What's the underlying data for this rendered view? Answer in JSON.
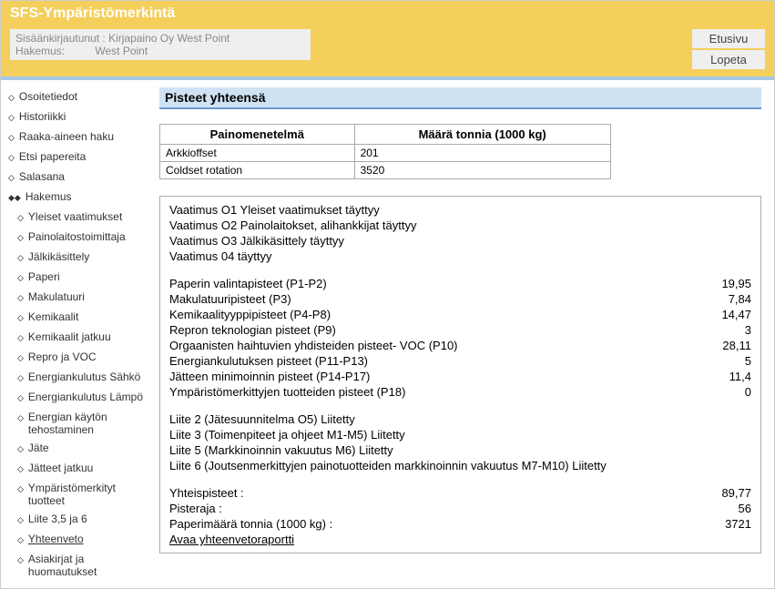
{
  "header": {
    "title": "SFS-Ympäristömerkintä",
    "loggedInLabel": "Sisäänkirjautunut :",
    "loggedInValue": "Kirjapaino Oy West Point",
    "appLabel": "Hakemus:",
    "appValue": "West Point",
    "btnHome": "Etusivu",
    "btnQuit": "Lopeta"
  },
  "sidebar": {
    "items": [
      {
        "label": "Osoitetiedot",
        "sub": false,
        "active": false
      },
      {
        "label": "Historiikki",
        "sub": false,
        "active": false
      },
      {
        "label": "Raaka-aineen haku",
        "sub": false,
        "active": false
      },
      {
        "label": "Etsi papereita",
        "sub": false,
        "active": false
      },
      {
        "label": "Salasana",
        "sub": false,
        "active": false
      },
      {
        "label": "Hakemus",
        "sub": false,
        "active": true
      },
      {
        "label": "Yleiset vaatimukset",
        "sub": true,
        "active": false
      },
      {
        "label": "Painolaitostoimittaja",
        "sub": true,
        "active": false
      },
      {
        "label": "Jälkikäsittely",
        "sub": true,
        "active": false
      },
      {
        "label": "Paperi",
        "sub": true,
        "active": false
      },
      {
        "label": "Makulatuuri",
        "sub": true,
        "active": false
      },
      {
        "label": "Kemikaalit",
        "sub": true,
        "active": false
      },
      {
        "label": "Kemikaalit jatkuu",
        "sub": true,
        "active": false
      },
      {
        "label": "Repro ja VOC",
        "sub": true,
        "active": false
      },
      {
        "label": "Energiankulutus Sähkö",
        "sub": true,
        "active": false
      },
      {
        "label": "Energiankulutus Lämpö",
        "sub": true,
        "active": false
      },
      {
        "label": "Energian käytön tehostaminen",
        "sub": true,
        "active": false
      },
      {
        "label": "Jäte",
        "sub": true,
        "active": false
      },
      {
        "label": "Jätteet jatkuu",
        "sub": true,
        "active": false
      },
      {
        "label": "Ympäristömerkityt tuotteet",
        "sub": true,
        "active": false
      },
      {
        "label": "Liite 3,5 ja 6",
        "sub": true,
        "active": false
      },
      {
        "label": "Yhteenveto",
        "sub": true,
        "active": false,
        "underline": true
      },
      {
        "label": "Asiakirjat ja huomautukset",
        "sub": true,
        "active": false
      }
    ]
  },
  "content": {
    "title": "Pisteet yhteensä",
    "tableHeaders": {
      "method": "Painomenetelmä",
      "amount": "Määrä tonnia (1000 kg)"
    },
    "tableRows": [
      {
        "method": "Arkkioffset",
        "amount": "201"
      },
      {
        "method": "Coldset rotation",
        "amount": "3520"
      }
    ],
    "reqs": [
      "Vaatimus O1 Yleiset vaatimukset täyttyy",
      "Vaatimus O2 Painolaitokset, alihankkijat täyttyy",
      "Vaatimus O3 Jälkikäsittely täyttyy",
      "Vaatimus 04 täyttyy"
    ],
    "scores": [
      {
        "label": "Paperin valintapisteet (P1-P2)",
        "value": "19,95"
      },
      {
        "label": "Makulatuuripisteet (P3)",
        "value": "7,84"
      },
      {
        "label": "Kemikaalityyppipisteet (P4-P8)",
        "value": "14,47"
      },
      {
        "label": "Repron teknologian pisteet (P9)",
        "value": "3"
      },
      {
        "label": "Orgaanisten haihtuvien yhdisteiden pisteet- VOC (P10)",
        "value": "28,11"
      },
      {
        "label": "Energiankulutuksen pisteet (P11-P13)",
        "value": "5"
      },
      {
        "label": "Jätteen minimoinnin pisteet (P14-P17)",
        "value": "11,4"
      },
      {
        "label": "Ympäristömerkittyjen tuotteiden pisteet (P18)",
        "value": "0"
      }
    ],
    "attachments": [
      "Liite 2 (Jätesuunnitelma O5) Liitetty",
      "Liite 3 (Toimenpiteet ja ohjeet M1-M5) Liitetty",
      "Liite 5 (Markkinoinnin vakuutus M6) Liitetty",
      "Liite 6 (Joutsenmerkittyjen painotuotteiden markkinoinnin vakuutus M7-M10) Liitetty"
    ],
    "totals": [
      {
        "label": "Yhteispisteet :",
        "value": "89,77"
      },
      {
        "label": "Pisteraja :",
        "value": "56"
      },
      {
        "label": "Paperimäärä tonnia (1000 kg) :",
        "value": "3721"
      }
    ],
    "reportLink": "Avaa yhteenvetoraportti"
  }
}
